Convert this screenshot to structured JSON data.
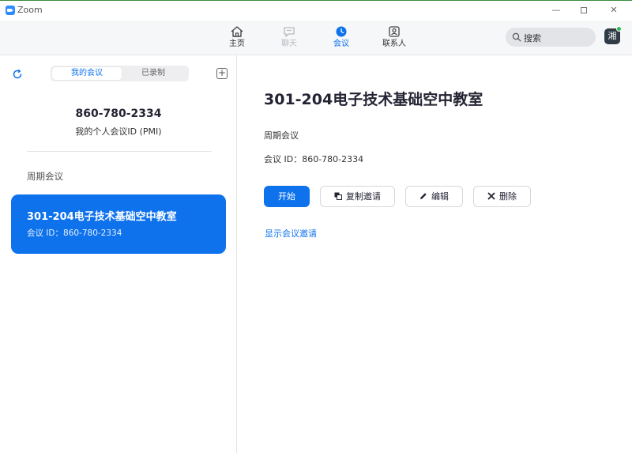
{
  "window": {
    "title": "Zoom",
    "minimize": "—",
    "close": "✕"
  },
  "nav": {
    "tabs": [
      {
        "label": "主页",
        "icon": "home-icon"
      },
      {
        "label": "聊天",
        "icon": "chat-icon"
      },
      {
        "label": "会议",
        "icon": "clock-icon"
      },
      {
        "label": "联系人",
        "icon": "contacts-icon"
      }
    ],
    "active_tab": "会议",
    "search": {
      "placeholder": "搜索"
    },
    "avatar_initial": "湘"
  },
  "left": {
    "segments": {
      "mine": "我的会议",
      "recorded": "已录制"
    },
    "add_symbol": "+",
    "pmi": {
      "number": "860-780-2334",
      "label": "我的个人会议ID (PMI)"
    },
    "section_title": "周期会议",
    "meetings": [
      {
        "title": "301-204电子技术基础空中教室",
        "id_line": "会议 ID：860-780-2334"
      }
    ]
  },
  "detail": {
    "title": "301-204电子技术基础空中教室",
    "type": "周期会议",
    "id_line": "会议 ID：860-780-2334",
    "buttons": {
      "start": "开始",
      "copy": "复制邀请",
      "edit": "编辑",
      "delete": "删除"
    },
    "show_invite_link": "显示会议邀请"
  },
  "colors": {
    "accent": "#0e72ed",
    "online": "#2fbf4f"
  }
}
